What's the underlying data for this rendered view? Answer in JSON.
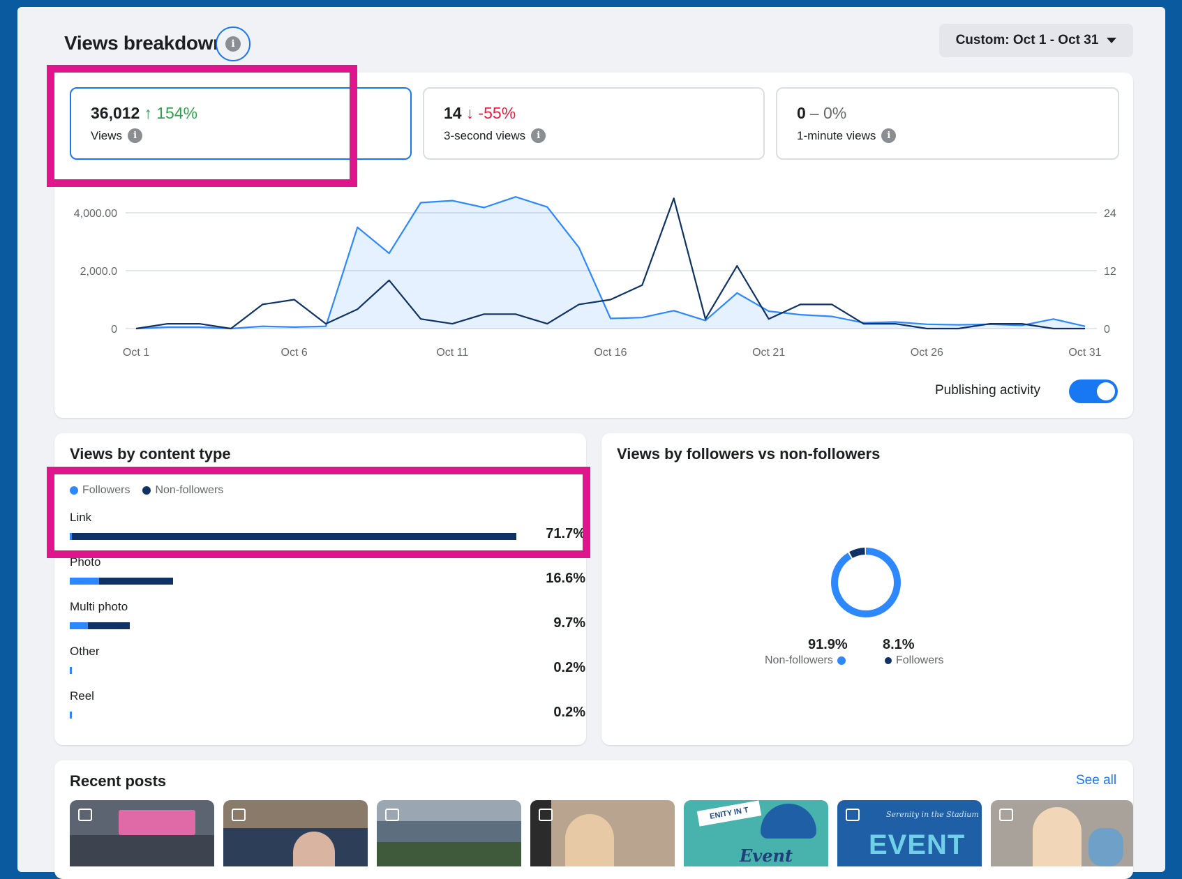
{
  "header": {
    "title": "Views breakdown",
    "date_range": "Custom: Oct 1 - Oct 31"
  },
  "metrics": [
    {
      "value": "36,012",
      "arrow": "↑",
      "change": "154%",
      "trend": "up",
      "label": "Views",
      "selected": true
    },
    {
      "value": "14",
      "arrow": "↓",
      "change": "-55%",
      "trend": "down",
      "label": "3-second views",
      "selected": false
    },
    {
      "value": "0",
      "arrow": "–",
      "change": "0%",
      "trend": "flat",
      "label": "1-minute views",
      "selected": false
    }
  ],
  "chart_data": {
    "type": "line",
    "x": [
      "Oct 1",
      "Oct 2",
      "Oct 3",
      "Oct 4",
      "Oct 5",
      "Oct 6",
      "Oct 7",
      "Oct 8",
      "Oct 9",
      "Oct 10",
      "Oct 11",
      "Oct 12",
      "Oct 13",
      "Oct 14",
      "Oct 15",
      "Oct 16",
      "Oct 17",
      "Oct 18",
      "Oct 19",
      "Oct 20",
      "Oct 21",
      "Oct 22",
      "Oct 23",
      "Oct 24",
      "Oct 25",
      "Oct 26",
      "Oct 27",
      "Oct 28",
      "Oct 29",
      "Oct 30",
      "Oct 31"
    ],
    "x_tick_labels": [
      "Oct 1",
      "Oct 6",
      "Oct 11",
      "Oct 16",
      "Oct 21",
      "Oct 26",
      "Oct 31"
    ],
    "y_left": {
      "ticks": [
        "0",
        "2,000.0",
        "4,000.00"
      ],
      "range": [
        0,
        4000
      ]
    },
    "y_right": {
      "ticks": [
        "0",
        "12",
        "24"
      ],
      "range": [
        0,
        24
      ]
    },
    "series": [
      {
        "axis": "left",
        "color": "#2d88ff",
        "fill": true,
        "values": [
          0,
          50,
          50,
          0,
          80,
          50,
          80,
          3500,
          2600,
          4350,
          4420,
          4180,
          4550,
          4200,
          2800,
          350,
          380,
          620,
          280,
          1230,
          600,
          480,
          420,
          200,
          230,
          150,
          130,
          150,
          110,
          330,
          80
        ]
      },
      {
        "axis": "right",
        "color": "#0e3266",
        "fill": false,
        "values": [
          0,
          1,
          1,
          0,
          5,
          6,
          1,
          4,
          10,
          2,
          1,
          3,
          3,
          1,
          5,
          6,
          9,
          27,
          2,
          13,
          2,
          5,
          5,
          1,
          1,
          0,
          0,
          1,
          1,
          0,
          0
        ]
      }
    ],
    "grid": true
  },
  "publishing": {
    "label": "Publishing activity",
    "on": true
  },
  "content_type": {
    "title": "Views by content type",
    "legend": {
      "followers": "Followers",
      "non_followers": "Non-followers"
    },
    "rows": [
      {
        "label": "Link",
        "pct": "71.7%",
        "followers_frac": 0.004,
        "non_followers_frac": 0.996,
        "scale": 1.0
      },
      {
        "label": "Photo",
        "pct": "16.6%",
        "followers_frac": 0.28,
        "non_followers_frac": 0.72,
        "scale": 0.232
      },
      {
        "label": "Multi photo",
        "pct": "9.7%",
        "followers_frac": 0.3,
        "non_followers_frac": 0.7,
        "scale": 0.135
      },
      {
        "label": "Other",
        "pct": "0.2%",
        "followers_frac": 1,
        "non_followers_frac": 0,
        "scale": 0.004
      },
      {
        "label": "Reel",
        "pct": "0.2%",
        "followers_frac": 1,
        "non_followers_frac": 0,
        "scale": 0.004
      }
    ]
  },
  "audience": {
    "title": "Views by followers vs non-followers",
    "non_followers": {
      "pct": "91.9%",
      "label": "Non-followers",
      "value": 0.919
    },
    "followers": {
      "pct": "8.1%",
      "label": "Followers",
      "value": 0.081
    }
  },
  "recent_posts": {
    "title": "Recent posts",
    "see_all": "See all",
    "thumbnails": [
      {
        "bg": "#5b6470"
      },
      {
        "bg": "#8a7a6a"
      },
      {
        "bg": "#9aa6b2"
      },
      {
        "bg": "#b9a58f"
      },
      {
        "bg": "#48b2ad",
        "text": "Event"
      },
      {
        "bg": "#1f5fa6",
        "text": "EVENT"
      },
      {
        "bg": "#a8a29b"
      }
    ],
    "post5_banner": "ENITY IN T",
    "post6_caption": "Serenity in the Stadium"
  },
  "colors": {
    "accent": "#1877f2",
    "followers": "#2d88ff",
    "non_followers": "#0e3266",
    "highlight": "#e0148c"
  }
}
